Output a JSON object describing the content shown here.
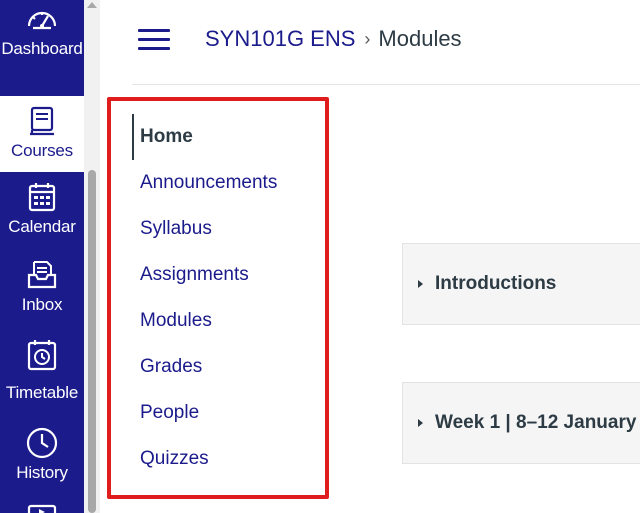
{
  "global_nav": {
    "items": [
      {
        "id": "dashboard",
        "label": "Dashboard",
        "icon": "dashboard-icon"
      },
      {
        "id": "courses",
        "label": "Courses",
        "icon": "courses-icon",
        "active": true
      },
      {
        "id": "calendar",
        "label": "Calendar",
        "icon": "calendar-icon"
      },
      {
        "id": "inbox",
        "label": "Inbox",
        "icon": "inbox-icon"
      },
      {
        "id": "timetable",
        "label": "Timetable",
        "icon": "timetable-icon"
      },
      {
        "id": "history",
        "label": "History",
        "icon": "history-icon"
      }
    ],
    "colors": {
      "background": "#1b1b8c",
      "active_background": "#ffffff"
    }
  },
  "header": {
    "course": "SYN101G ENS",
    "separator": "›",
    "current_page": "Modules"
  },
  "course_nav": {
    "items": [
      {
        "label": "Home",
        "active": true
      },
      {
        "label": "Announcements"
      },
      {
        "label": "Syllabus"
      },
      {
        "label": "Assignments"
      },
      {
        "label": "Modules"
      },
      {
        "label": "Grades"
      },
      {
        "label": "People"
      },
      {
        "label": "Quizzes"
      }
    ],
    "highlight_color": "#e01d1d"
  },
  "modules": [
    {
      "title": "Introductions",
      "collapsed": true
    },
    {
      "title": "Week 1 | 8–12 January",
      "collapsed": true
    }
  ],
  "colors": {
    "link": "#1b1b8c",
    "text": "#2d3b45"
  }
}
